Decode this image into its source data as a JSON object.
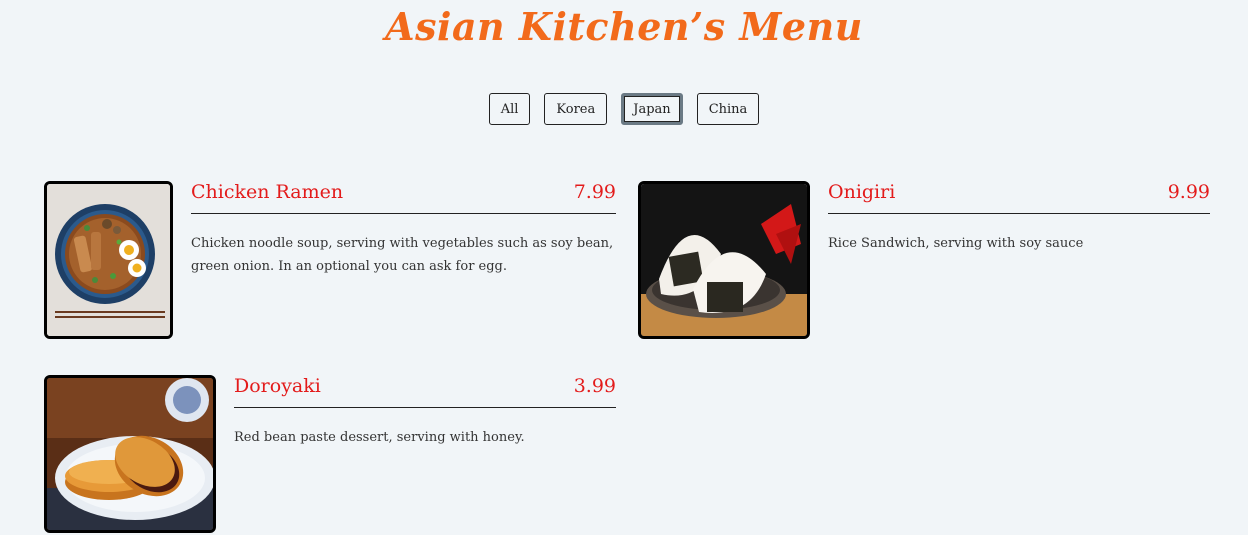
{
  "page": {
    "title": "Asian Kitchen’s Menu"
  },
  "colors": {
    "accent": "#e31b1b",
    "title": "#f26a1b",
    "background": "#f1f5f8"
  },
  "filters": [
    {
      "label": "All",
      "active": false
    },
    {
      "label": "Korea",
      "active": false
    },
    {
      "label": "Japan",
      "active": true
    },
    {
      "label": "China",
      "active": false
    }
  ],
  "items": [
    {
      "name": "Chicken Ramen",
      "price": "7.99",
      "description": "Chicken noodle soup, serving with vegetables such as soy bean, green onion. In an optional you can ask for egg.",
      "image": "ramen-bowl-photo"
    },
    {
      "name": "Onigiri",
      "price": "9.99",
      "description": "Rice Sandwich, serving with soy sauce",
      "image": "onigiri-photo"
    },
    {
      "name": "Doroyaki",
      "price": "3.99",
      "description": "Red bean paste dessert, serving with honey.",
      "image": "dorayaki-photo"
    }
  ]
}
